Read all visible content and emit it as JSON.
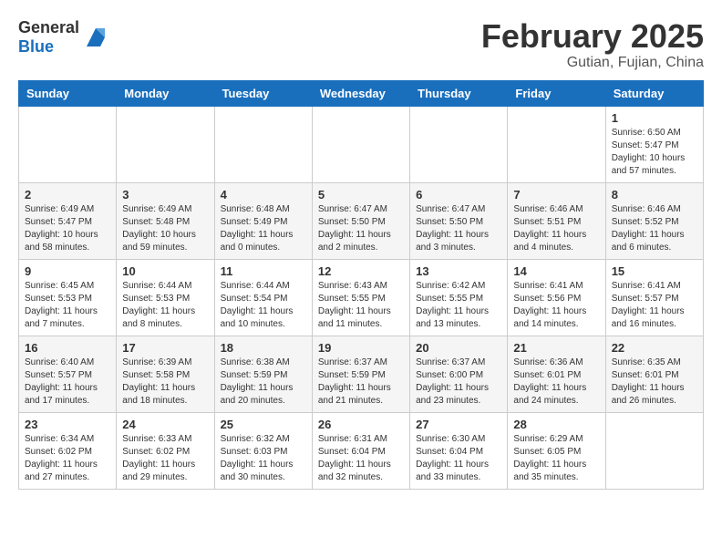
{
  "header": {
    "logo_general": "General",
    "logo_blue": "Blue",
    "month_year": "February 2025",
    "location": "Gutian, Fujian, China"
  },
  "days_of_week": [
    "Sunday",
    "Monday",
    "Tuesday",
    "Wednesday",
    "Thursday",
    "Friday",
    "Saturday"
  ],
  "weeks": [
    [
      {
        "day": "",
        "info": ""
      },
      {
        "day": "",
        "info": ""
      },
      {
        "day": "",
        "info": ""
      },
      {
        "day": "",
        "info": ""
      },
      {
        "day": "",
        "info": ""
      },
      {
        "day": "",
        "info": ""
      },
      {
        "day": "1",
        "info": "Sunrise: 6:50 AM\nSunset: 5:47 PM\nDaylight: 10 hours and 57 minutes."
      }
    ],
    [
      {
        "day": "2",
        "info": "Sunrise: 6:49 AM\nSunset: 5:47 PM\nDaylight: 10 hours and 58 minutes."
      },
      {
        "day": "3",
        "info": "Sunrise: 6:49 AM\nSunset: 5:48 PM\nDaylight: 10 hours and 59 minutes."
      },
      {
        "day": "4",
        "info": "Sunrise: 6:48 AM\nSunset: 5:49 PM\nDaylight: 11 hours and 0 minutes."
      },
      {
        "day": "5",
        "info": "Sunrise: 6:47 AM\nSunset: 5:50 PM\nDaylight: 11 hours and 2 minutes."
      },
      {
        "day": "6",
        "info": "Sunrise: 6:47 AM\nSunset: 5:50 PM\nDaylight: 11 hours and 3 minutes."
      },
      {
        "day": "7",
        "info": "Sunrise: 6:46 AM\nSunset: 5:51 PM\nDaylight: 11 hours and 4 minutes."
      },
      {
        "day": "8",
        "info": "Sunrise: 6:46 AM\nSunset: 5:52 PM\nDaylight: 11 hours and 6 minutes."
      }
    ],
    [
      {
        "day": "9",
        "info": "Sunrise: 6:45 AM\nSunset: 5:53 PM\nDaylight: 11 hours and 7 minutes."
      },
      {
        "day": "10",
        "info": "Sunrise: 6:44 AM\nSunset: 5:53 PM\nDaylight: 11 hours and 8 minutes."
      },
      {
        "day": "11",
        "info": "Sunrise: 6:44 AM\nSunset: 5:54 PM\nDaylight: 11 hours and 10 minutes."
      },
      {
        "day": "12",
        "info": "Sunrise: 6:43 AM\nSunset: 5:55 PM\nDaylight: 11 hours and 11 minutes."
      },
      {
        "day": "13",
        "info": "Sunrise: 6:42 AM\nSunset: 5:55 PM\nDaylight: 11 hours and 13 minutes."
      },
      {
        "day": "14",
        "info": "Sunrise: 6:41 AM\nSunset: 5:56 PM\nDaylight: 11 hours and 14 minutes."
      },
      {
        "day": "15",
        "info": "Sunrise: 6:41 AM\nSunset: 5:57 PM\nDaylight: 11 hours and 16 minutes."
      }
    ],
    [
      {
        "day": "16",
        "info": "Sunrise: 6:40 AM\nSunset: 5:57 PM\nDaylight: 11 hours and 17 minutes."
      },
      {
        "day": "17",
        "info": "Sunrise: 6:39 AM\nSunset: 5:58 PM\nDaylight: 11 hours and 18 minutes."
      },
      {
        "day": "18",
        "info": "Sunrise: 6:38 AM\nSunset: 5:59 PM\nDaylight: 11 hours and 20 minutes."
      },
      {
        "day": "19",
        "info": "Sunrise: 6:37 AM\nSunset: 5:59 PM\nDaylight: 11 hours and 21 minutes."
      },
      {
        "day": "20",
        "info": "Sunrise: 6:37 AM\nSunset: 6:00 PM\nDaylight: 11 hours and 23 minutes."
      },
      {
        "day": "21",
        "info": "Sunrise: 6:36 AM\nSunset: 6:01 PM\nDaylight: 11 hours and 24 minutes."
      },
      {
        "day": "22",
        "info": "Sunrise: 6:35 AM\nSunset: 6:01 PM\nDaylight: 11 hours and 26 minutes."
      }
    ],
    [
      {
        "day": "23",
        "info": "Sunrise: 6:34 AM\nSunset: 6:02 PM\nDaylight: 11 hours and 27 minutes."
      },
      {
        "day": "24",
        "info": "Sunrise: 6:33 AM\nSunset: 6:02 PM\nDaylight: 11 hours and 29 minutes."
      },
      {
        "day": "25",
        "info": "Sunrise: 6:32 AM\nSunset: 6:03 PM\nDaylight: 11 hours and 30 minutes."
      },
      {
        "day": "26",
        "info": "Sunrise: 6:31 AM\nSunset: 6:04 PM\nDaylight: 11 hours and 32 minutes."
      },
      {
        "day": "27",
        "info": "Sunrise: 6:30 AM\nSunset: 6:04 PM\nDaylight: 11 hours and 33 minutes."
      },
      {
        "day": "28",
        "info": "Sunrise: 6:29 AM\nSunset: 6:05 PM\nDaylight: 11 hours and 35 minutes."
      },
      {
        "day": "",
        "info": ""
      }
    ]
  ]
}
